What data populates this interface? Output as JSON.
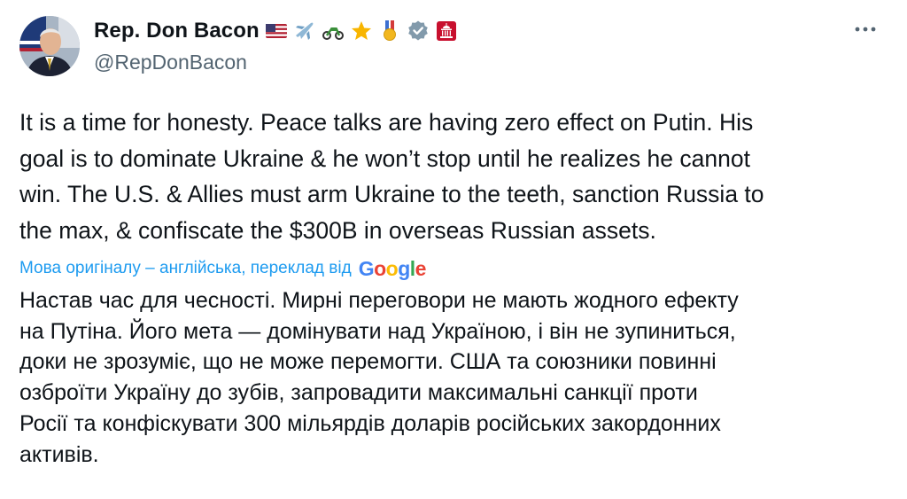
{
  "author": {
    "name": "Rep. Don Bacon",
    "handle": "@RepDonBacon",
    "name_emojis": [
      "us-flag-icon",
      "airplane-icon",
      "motorcycle-icon",
      "star-icon",
      "medal-icon",
      "verified-badge-icon",
      "capitol-affiliate-icon"
    ]
  },
  "tweet": {
    "text": "It is a time for honesty. Peace talks are having zero effect on Putin. His\ngoal is to dominate Ukraine & he won’t stop until he realizes he cannot\nwin. The U.S. & Allies must arm Ukraine to the teeth, sanction Russia to\nthe max, & confiscate the $300B in overseas Russian assets."
  },
  "translation": {
    "label": "Мова оригіналу – англійська, переклад від",
    "provider_letters": [
      "G",
      "o",
      "o",
      "g",
      "l",
      "e"
    ],
    "provider_colors": [
      "#4285F4",
      "#EA4335",
      "#FBBC05",
      "#4285F4",
      "#34A853",
      "#EA4335"
    ],
    "text": "Настав час для чесності. Мирні переговори не мають жодного ефекту\nна Путіна. Його мета — домінувати над Україною, і він не зупиниться,\nдоки не зрозуміє, що не може перемогти. США та союзники повинні\nозброїти Україну до зубів, запровадити максимальні санкції проти\nРосії та конфіскувати 300 мільярдів доларів російських закордонних\nактивів."
  },
  "colors": {
    "text": "#0f1419",
    "secondary": "#536471",
    "link": "#1d9bf0",
    "verified_gray": "#829aab",
    "affiliate_red": "#c8102e"
  }
}
